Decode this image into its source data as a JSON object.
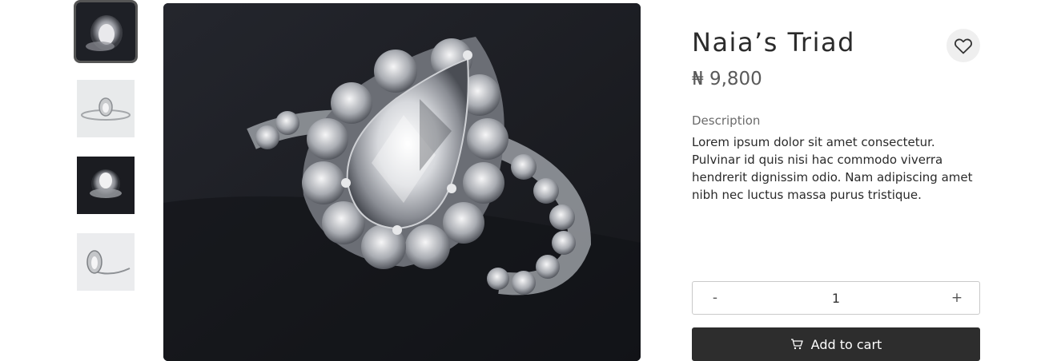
{
  "product": {
    "title": "Naia’s Triad",
    "price": "₦ 9,800",
    "description_label": "Description",
    "description": "Lorem ipsum dolor sit amet consectetur. Pulvinar id quis nisi hac commodo viverra hendrerit dignissim odio. Nam adipiscing amet nibh nec luctus massa purus tristique."
  },
  "gallery": {
    "thumbnails": [
      {
        "name": "ring-triad-dark-background",
        "selected": true
      },
      {
        "name": "pear-ring-light-background",
        "selected": false
      },
      {
        "name": "ring-set-dark-background",
        "selected": false
      },
      {
        "name": "pear-ring-side-view",
        "selected": false
      }
    ]
  },
  "quantity": {
    "decrement_label": "-",
    "value": "1",
    "increment_label": "+"
  },
  "cart": {
    "label": "Add to cart",
    "icon": "cart-icon"
  },
  "favorite": {
    "icon": "heart-icon"
  },
  "colors": {
    "cart_button": "#2d2d2d",
    "favorite_bg": "#efefef"
  }
}
